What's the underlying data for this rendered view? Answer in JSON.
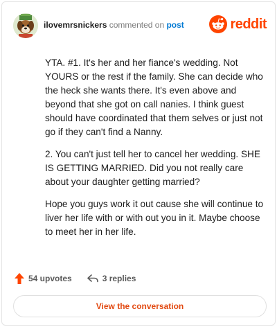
{
  "header": {
    "username": "ilovemrsnickers",
    "action_text": "commented on",
    "post_link": "post",
    "brand_name": "reddit",
    "brand_color": "#ff4500"
  },
  "comment": {
    "paragraphs": [
      "YTA. #1. It's her and her fiance's wedding. Not YOURS or the rest if the family. She can decide who the heck she wants there. It's even above and beyond that she got on call nanies. I think guest should have coordinated that them selves or just not go if they can't find a Nanny.",
      "2. You can't just tell her to cancel her wedding. SHE IS GETTING MARRIED. Did you not really care about your daughter getting married?",
      "Hope you guys work it out cause she will continue to liver her life with or with out you in it. Maybe choose to meet her in her life."
    ]
  },
  "actions": {
    "upvotes_label": "54 upvotes",
    "replies_label": "3 replies",
    "upvote_icon": "upvote-arrow-icon",
    "reply_icon": "reply-arrow-icon",
    "upvote_color": "#ff4500"
  },
  "cta": {
    "label": "View the conversation",
    "color": "#e24a12"
  }
}
